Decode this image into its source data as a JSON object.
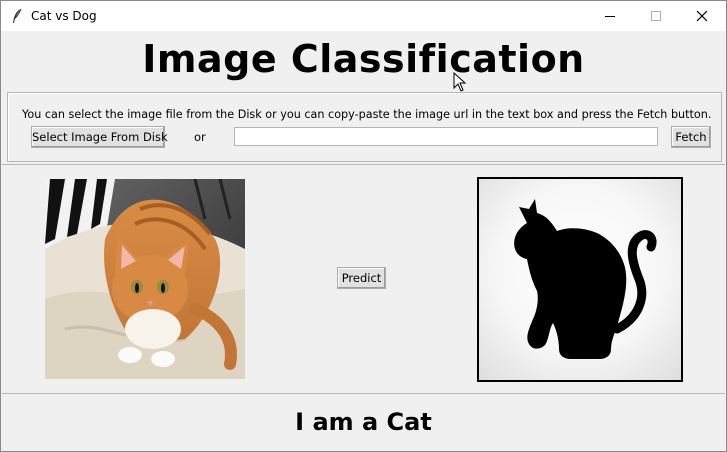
{
  "window": {
    "title": "Cat vs Dog",
    "controls": {
      "minimize": "minimize-icon",
      "maximize": "maximize-icon",
      "close": "close-icon"
    }
  },
  "heading": "Image Classification",
  "input_panel": {
    "instructions": "You can select the image file from the Disk or you can copy-paste the image url in the text box and press the Fetch button.",
    "select_button": "Select Image From Disk",
    "or_label": "or",
    "url_value": "",
    "fetch_button": "Fetch"
  },
  "image_panel": {
    "photo_icon": "cat-photo",
    "predict_button": "Predict",
    "result_icon": "cat-silhouette-icon"
  },
  "result": "I am a Cat"
}
